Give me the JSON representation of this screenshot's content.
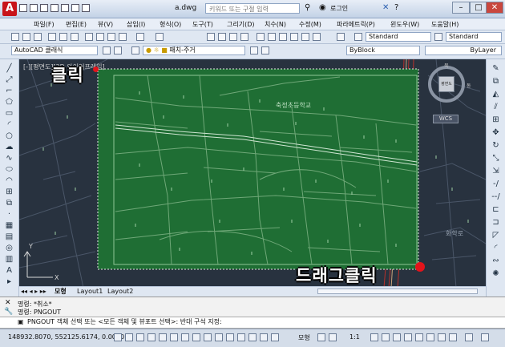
{
  "titlebar": {
    "logo": "A",
    "doc_title": "a.dwg",
    "search_placeholder": "키워드 또는 구절 입력",
    "login": "로그인",
    "minimize": "–",
    "maximize": "□",
    "close": "✕"
  },
  "menu": [
    "파일(F)",
    "편집(E)",
    "뷰(V)",
    "삽입(I)",
    "형식(O)",
    "도구(T)",
    "그리기(D)",
    "치수(N)",
    "수정(M)",
    "파라메트릭(P)",
    "윈도우(W)",
    "도움말(H)"
  ],
  "styles": {
    "text_style": "Standard",
    "dim_style": "Standard"
  },
  "workspace": "AutoCAD 클래식",
  "layer": "패치-주거",
  "color": "ByBlock",
  "linetype": "ByLayer",
  "viewport": {
    "label": "[-][평면도][2D 와이어프레임]",
    "compass_center": "평면도",
    "compass_north": "북",
    "compass_east": "동",
    "wcs": "WCS",
    "map_labels": [
      "축정초등학교",
      "화학로"
    ]
  },
  "annotations": {
    "click": "클릭",
    "drag_click": "드래그클릭"
  },
  "tabs": {
    "model": "모형",
    "layout1": "Layout1",
    "layout2": "Layout2"
  },
  "command": {
    "history1": "명령: *취소*",
    "history2": "명령: PNGOUT",
    "prompt": "PNGOUT 객체 선택 또는 <모든 객체 및 뷰포트 선택>: 반대 구석 지정:"
  },
  "status": {
    "coordinates": "148932.8070, 552125.6174, 0.0000",
    "model": "모형",
    "scale": "1:1"
  },
  "colors": {
    "selection_fill": "#1f6e34",
    "canvas_bg": "#28323f",
    "accent_red": "#e3141b"
  }
}
